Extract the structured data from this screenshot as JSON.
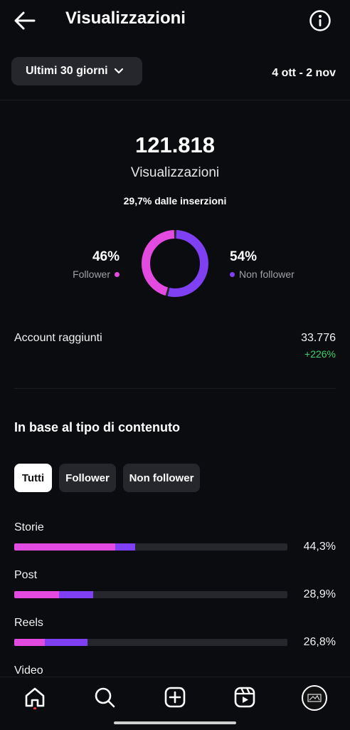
{
  "header": {
    "title": "Visualizzazioni"
  },
  "filters": {
    "range_label": "Ultimi 30 giorni",
    "date_range": "4 ott - 2 nov"
  },
  "summary": {
    "total": "121.818",
    "label": "Visualizzazioni",
    "ads_share": "29,7% dalle inserzioni"
  },
  "split": {
    "follower_pct": "46%",
    "follower_label": "Follower",
    "follower_value": 0.46,
    "non_follower_pct": "54%",
    "non_follower_label": "Non follower",
    "non_follower_value": 0.54,
    "follower_color": "#e34be0",
    "non_follower_color": "#7f3ff2"
  },
  "accounts": {
    "label": "Account raggiunti",
    "value": "33.776",
    "delta": "+226%"
  },
  "content_type": {
    "title": "In base al tipo di contenuto",
    "chips": [
      "Tutti",
      "Follower",
      "Non follower"
    ],
    "rows": [
      {
        "label": "Storie",
        "pct": "44,3%",
        "follower_share": 37,
        "non_follower_share": 7.3
      },
      {
        "label": "Post",
        "pct": "28,9%",
        "follower_share": 16.5,
        "non_follower_share": 12.4
      },
      {
        "label": "Reels",
        "pct": "26,8%",
        "follower_share": 11.3,
        "non_follower_share": 15.5
      },
      {
        "label": "Video"
      }
    ]
  },
  "bottom_nav": {
    "items": [
      "home-icon",
      "search-icon",
      "create-icon",
      "reels-icon",
      "profile-avatar"
    ]
  }
}
